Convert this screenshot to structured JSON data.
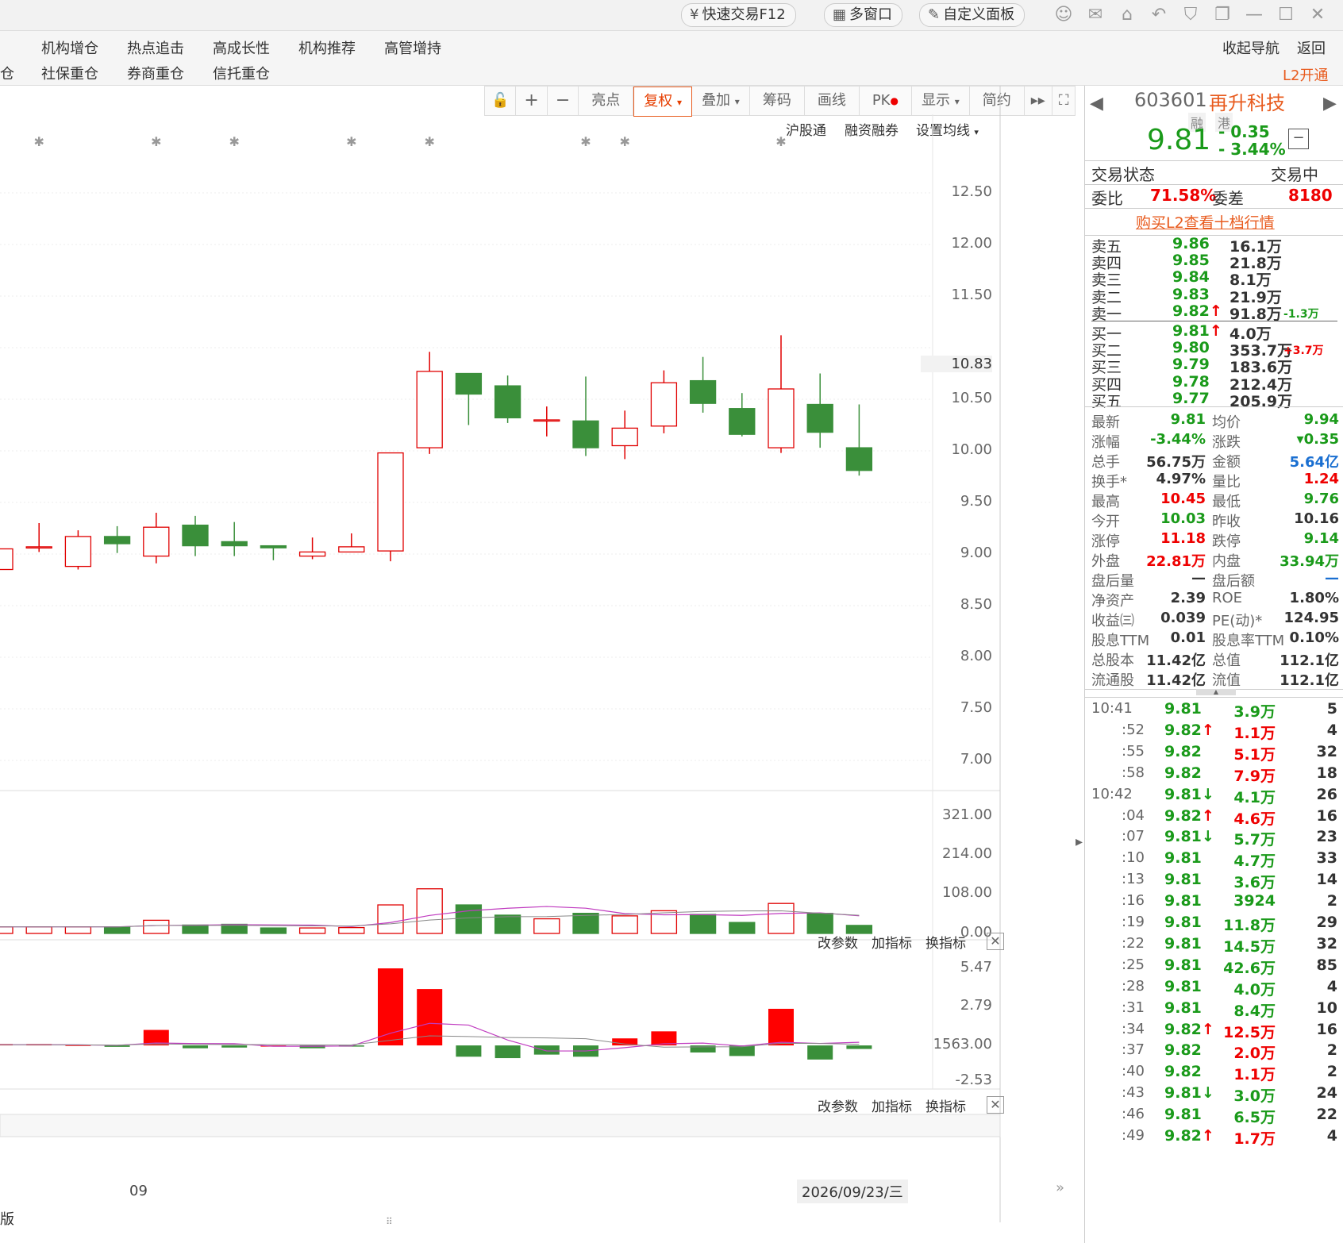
{
  "titlebar": {
    "quick_trade": "快速交易F12",
    "multi_window": "多窗口",
    "custom_panel": "自定义面板"
  },
  "nav": {
    "row1": [
      "机构增仓",
      "热点追击",
      "高成长性",
      "机构推荐",
      "高管增持"
    ],
    "row2": [
      "社保重仓",
      "券商重仓",
      "信托重仓"
    ],
    "row1_cut": "",
    "row2_cut": "仓",
    "collapse": "收起导航",
    "back": "返回",
    "l2": "L2开通"
  },
  "toolbar": {
    "items": [
      "亮点",
      "复权",
      "叠加",
      "筹码",
      "画线",
      "PK",
      "显示",
      "简约"
    ],
    "active": "复权"
  },
  "chart_links": [
    "沪股通",
    "融资融券",
    "设置均线"
  ],
  "indicator_links": [
    "改参数",
    "加指标",
    "换指标"
  ],
  "price_axis": [
    "12.50",
    "12.00",
    "11.50",
    "10.83",
    "10.50",
    "10.00",
    "9.50",
    "9.00",
    "8.50",
    "8.00",
    "7.50",
    "7.00"
  ],
  "vol_axis": [
    "321.00",
    "214.00",
    "108.00",
    "0.00"
  ],
  "macd_axis": [
    "5.47",
    "2.79",
    "1563.00",
    "-2.53"
  ],
  "date_axis": {
    "month": "09",
    "cursor_date": "2026/09/23/三"
  },
  "bottom_cut": "版",
  "chart_data": {
    "type": "candlestick",
    "ylim": [
      7.0,
      12.5
    ],
    "candles": [
      {
        "o": 8.85,
        "c": 9.05,
        "h": 9.05,
        "l": 8.85
      },
      {
        "o": 9.07,
        "c": 9.07,
        "h": 9.3,
        "l": 9.02
      },
      {
        "o": 8.88,
        "c": 9.17,
        "h": 9.23,
        "l": 8.85
      },
      {
        "o": 9.17,
        "c": 9.1,
        "h": 9.27,
        "l": 9.01
      },
      {
        "o": 8.98,
        "c": 9.26,
        "h": 9.4,
        "l": 8.91
      },
      {
        "o": 9.28,
        "c": 9.08,
        "h": 9.37,
        "l": 8.98
      },
      {
        "o": 9.12,
        "c": 9.08,
        "h": 9.31,
        "l": 8.98
      },
      {
        "o": 9.08,
        "c": 9.06,
        "h": 9.08,
        "l": 8.94
      },
      {
        "o": 8.98,
        "c": 9.02,
        "h": 9.16,
        "l": 8.95
      },
      {
        "o": 9.02,
        "c": 9.07,
        "h": 9.2,
        "l": 9.02
      },
      {
        "o": 9.03,
        "c": 9.98,
        "h": 9.98,
        "l": 8.93
      },
      {
        "o": 10.03,
        "c": 10.77,
        "h": 10.96,
        "l": 9.97
      },
      {
        "o": 10.75,
        "c": 10.55,
        "h": 10.75,
        "l": 10.25
      },
      {
        "o": 10.63,
        "c": 10.32,
        "h": 10.73,
        "l": 10.27
      },
      {
        "o": 10.3,
        "c": 10.3,
        "h": 10.43,
        "l": 10.14
      },
      {
        "o": 10.29,
        "c": 10.03,
        "h": 10.72,
        "l": 9.95
      },
      {
        "o": 10.05,
        "c": 10.22,
        "h": 10.39,
        "l": 9.92
      },
      {
        "o": 10.24,
        "c": 10.66,
        "h": 10.78,
        "l": 10.17
      },
      {
        "o": 10.68,
        "c": 10.46,
        "h": 10.91,
        "l": 10.37
      },
      {
        "o": 10.41,
        "c": 10.16,
        "h": 10.56,
        "l": 10.14
      },
      {
        "o": 10.03,
        "c": 10.6,
        "h": 11.12,
        "l": 9.98
      },
      {
        "o": 10.45,
        "c": 10.18,
        "h": 10.75,
        "l": 10.03
      },
      {
        "o": 10.03,
        "c": 9.81,
        "h": 10.45,
        "l": 9.76
      }
    ],
    "volume": [
      18,
      18,
      18,
      18,
      36,
      23,
      25,
      15,
      15,
      16,
      78,
      122,
      78,
      50,
      40,
      55,
      48,
      62,
      52,
      30,
      82,
      55,
      22
    ],
    "volume_ylim": [
      0,
      321
    ],
    "macd": [
      0.1,
      0.1,
      0.05,
      -0.1,
      1.1,
      -0.2,
      -0.15,
      0,
      -0.2,
      -0.05,
      5.47,
      4.0,
      -0.8,
      -0.9,
      -0.65,
      -0.8,
      0.5,
      1.0,
      -0.5,
      -0.75,
      2.6,
      -1.0,
      -0.25
    ],
    "macd_ylim": [
      -2.53,
      5.47
    ]
  },
  "stock": {
    "code": "603601",
    "name": "再升科技",
    "tags": [
      "融",
      "港"
    ],
    "price": "9.81",
    "change": "- 0.35",
    "change_pct": "- 3.44%",
    "status_label": "交易状态",
    "status_value": "交易中",
    "wei_bi_label": "委比",
    "wei_bi": "71.58%",
    "wei_cha_label": "委差",
    "wei_cha": "8180",
    "l2_link": "购买L2查看十档行情"
  },
  "asks": [
    {
      "label": "卖五",
      "price": "9.86",
      "vol": "16.1万",
      "diff": ""
    },
    {
      "label": "卖四",
      "price": "9.85",
      "vol": "21.8万",
      "diff": ""
    },
    {
      "label": "卖三",
      "price": "9.84",
      "vol": "8.1万",
      "diff": ""
    },
    {
      "label": "卖二",
      "price": "9.83",
      "vol": "21.9万",
      "diff": ""
    },
    {
      "label": "卖一",
      "price": "9.82",
      "vol": "91.8万",
      "diff": "-1.3万",
      "arrow": "↑"
    }
  ],
  "bids": [
    {
      "label": "买一",
      "price": "9.81",
      "vol": "4.0万",
      "diff": "",
      "arrow": "↑"
    },
    {
      "label": "买二",
      "price": "9.80",
      "vol": "353.7万",
      "diff": "+3.7万"
    },
    {
      "label": "买三",
      "price": "9.79",
      "vol": "183.6万",
      "diff": ""
    },
    {
      "label": "买四",
      "price": "9.78",
      "vol": "212.4万",
      "diff": ""
    },
    {
      "label": "买五",
      "price": "9.77",
      "vol": "205.9万",
      "diff": ""
    }
  ],
  "stats": [
    {
      "l1": "最新",
      "v1": "9.81",
      "c1": "green",
      "l2": "均价",
      "v2": "9.94",
      "c2": "green"
    },
    {
      "l1": "涨幅",
      "v1": "-3.44%",
      "c1": "green",
      "l2": "涨跌",
      "v2": "▾0.35",
      "c2": "green"
    },
    {
      "l1": "总手",
      "v1": "56.75万",
      "c1": "dark",
      "l2": "金额",
      "v2": "5.64亿",
      "c2": "blue"
    },
    {
      "l1": "换手*",
      "v1": "4.97%",
      "c1": "dark",
      "l2": "量比",
      "v2": "1.24",
      "c2": "red"
    },
    {
      "l1": "最高",
      "v1": "10.45",
      "c1": "red",
      "l2": "最低",
      "v2": "9.76",
      "c2": "green"
    },
    {
      "l1": "今开",
      "v1": "10.03",
      "c1": "green",
      "l2": "昨收",
      "v2": "10.16",
      "c2": "dark"
    },
    {
      "l1": "涨停",
      "v1": "11.18",
      "c1": "red",
      "l2": "跌停",
      "v2": "9.14",
      "c2": "green"
    },
    {
      "l1": "外盘",
      "v1": "22.81万",
      "c1": "red",
      "l2": "内盘",
      "v2": "33.94万",
      "c2": "green"
    },
    {
      "l1": "盘后量",
      "v1": "—",
      "c1": "dark",
      "l2": "盘后额",
      "v2": "—",
      "c2": "blue"
    },
    {
      "l1": "净资产",
      "v1": "2.39",
      "c1": "dark",
      "l2": "ROE",
      "v2": "1.80%",
      "c2": "dark"
    },
    {
      "l1": "收益㈢",
      "v1": "0.039",
      "c1": "dark",
      "l2": "PE(动)*",
      "v2": "124.95",
      "c2": "dark"
    },
    {
      "l1": "股息TTM",
      "v1": "0.01",
      "c1": "dark",
      "l2": "股息率TTM",
      "v2": "0.10%",
      "c2": "dark"
    },
    {
      "l1": "总股本",
      "v1": "11.42亿",
      "c1": "dark",
      "l2": "总值",
      "v2": "112.1亿",
      "c2": "dark"
    },
    {
      "l1": "流通股",
      "v1": "11.42亿",
      "c1": "dark",
      "l2": "流值",
      "v2": "112.1亿",
      "c2": "dark"
    }
  ],
  "ticks": [
    {
      "t": "10:41",
      "p": "9.81",
      "a": "",
      "v": "3.9万",
      "n": "5",
      "vc": "green"
    },
    {
      "t": ":52",
      "p": "9.82",
      "a": "↑",
      "v": "1.1万",
      "n": "4",
      "vc": "red"
    },
    {
      "t": ":55",
      "p": "9.82",
      "a": "",
      "v": "5.1万",
      "n": "32",
      "vc": "red"
    },
    {
      "t": ":58",
      "p": "9.82",
      "a": "",
      "v": "7.9万",
      "n": "18",
      "vc": "red"
    },
    {
      "t": "10:42",
      "p": "9.81",
      "a": "↓",
      "v": "4.1万",
      "n": "26",
      "vc": "green"
    },
    {
      "t": ":04",
      "p": "9.82",
      "a": "↑",
      "v": "4.6万",
      "n": "16",
      "vc": "red"
    },
    {
      "t": ":07",
      "p": "9.81",
      "a": "↓",
      "v": "5.7万",
      "n": "23",
      "vc": "green"
    },
    {
      "t": ":10",
      "p": "9.81",
      "a": "",
      "v": "4.7万",
      "n": "33",
      "vc": "green"
    },
    {
      "t": ":13",
      "p": "9.81",
      "a": "",
      "v": "3.6万",
      "n": "14",
      "vc": "green"
    },
    {
      "t": ":16",
      "p": "9.81",
      "a": "",
      "v": "3924",
      "n": "2",
      "vc": "green"
    },
    {
      "t": ":19",
      "p": "9.81",
      "a": "",
      "v": "11.8万",
      "n": "29",
      "vc": "green"
    },
    {
      "t": ":22",
      "p": "9.81",
      "a": "",
      "v": "14.5万",
      "n": "32",
      "vc": "green"
    },
    {
      "t": ":25",
      "p": "9.81",
      "a": "",
      "v": "42.6万",
      "n": "85",
      "vc": "green"
    },
    {
      "t": ":28",
      "p": "9.81",
      "a": "",
      "v": "4.0万",
      "n": "4",
      "vc": "green"
    },
    {
      "t": ":31",
      "p": "9.81",
      "a": "",
      "v": "8.4万",
      "n": "10",
      "vc": "green"
    },
    {
      "t": ":34",
      "p": "9.82",
      "a": "↑",
      "v": "12.5万",
      "n": "16",
      "vc": "red"
    },
    {
      "t": ":37",
      "p": "9.82",
      "a": "",
      "v": "2.0万",
      "n": "2",
      "vc": "red"
    },
    {
      "t": ":40",
      "p": "9.82",
      "a": "",
      "v": "1.1万",
      "n": "2",
      "vc": "red"
    },
    {
      "t": ":43",
      "p": "9.81",
      "a": "↓",
      "v": "3.0万",
      "n": "24",
      "vc": "green"
    },
    {
      "t": ":46",
      "p": "9.81",
      "a": "",
      "v": "6.5万",
      "n": "22",
      "vc": "green"
    },
    {
      "t": ":49",
      "p": "9.82",
      "a": "↑",
      "v": "1.7万",
      "n": "4",
      "vc": "red"
    }
  ],
  "colors": {
    "up": "#e00000",
    "down": "#3a8f3a",
    "accent": "#e85b1e"
  }
}
